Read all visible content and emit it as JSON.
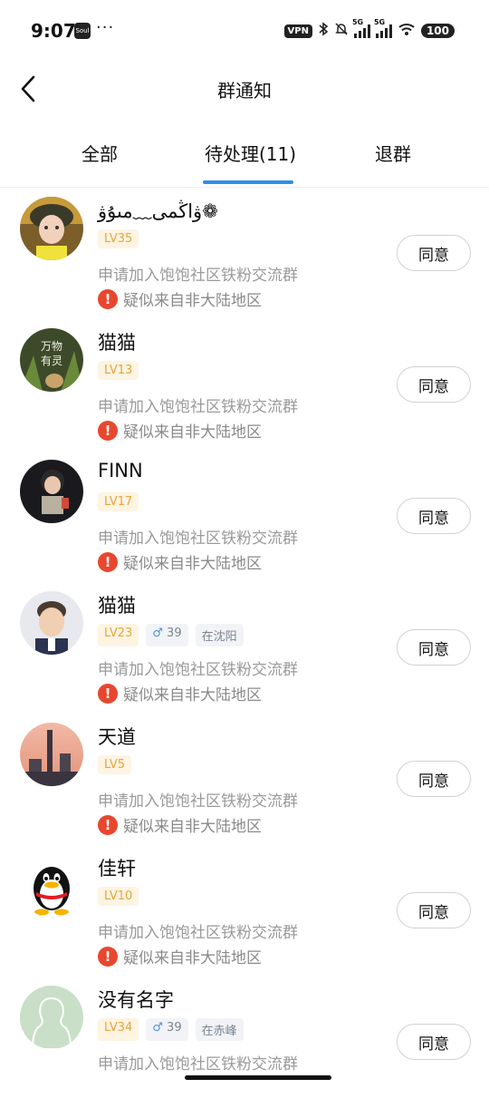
{
  "status": {
    "time": "9:07",
    "app_icon_text": "Soul",
    "more": "···",
    "vpn": "VPN",
    "net1": "5G",
    "net2": "5G",
    "battery": "100"
  },
  "header": {
    "title": "群通知",
    "back_icon": "chevron-left-icon"
  },
  "tabs": [
    {
      "label": "全部",
      "selected": false
    },
    {
      "label": "待处理(11)",
      "selected": true
    },
    {
      "label": "退群",
      "selected": false
    }
  ],
  "accent": "#2f8fea",
  "warning_color": "#e8472f",
  "items": [
    {
      "name": "ۋاڭمى﹏مىۇۋ❁",
      "level": "LV35",
      "request": "申请加入饱饱社区铁粉交流群",
      "warning": "疑似来自非大陆地区",
      "button": "同意"
    },
    {
      "name": "猫猫",
      "level": "LV13",
      "request": "申请加入饱饱社区铁粉交流群",
      "warning": "疑似来自非大陆地区",
      "button": "同意"
    },
    {
      "name": "FINN",
      "level": "LV17",
      "request": "申请加入饱饱社区铁粉交流群",
      "warning": "疑似来自非大陆地区",
      "button": "同意"
    },
    {
      "name": "猫猫",
      "level": "LV23",
      "gender": "♂",
      "age": "39",
      "location": "在沈阳",
      "request": "申请加入饱饱社区铁粉交流群",
      "warning": "疑似来自非大陆地区",
      "button": "同意"
    },
    {
      "name": "天道",
      "level": "LV5",
      "request": "申请加入饱饱社区铁粉交流群",
      "warning": "疑似来自非大陆地区",
      "button": "同意"
    },
    {
      "name": "佳轩",
      "level": "LV10",
      "request": "申请加入饱饱社区铁粉交流群",
      "warning": "疑似来自非大陆地区",
      "button": "同意"
    },
    {
      "name": "没有名字",
      "level": "LV34",
      "gender": "♂",
      "age": "39",
      "location": "在赤峰",
      "request": "申请加入饱饱社区铁粉交流群",
      "button": "同意"
    }
  ],
  "avatar2_text": [
    "万物",
    "有灵"
  ]
}
